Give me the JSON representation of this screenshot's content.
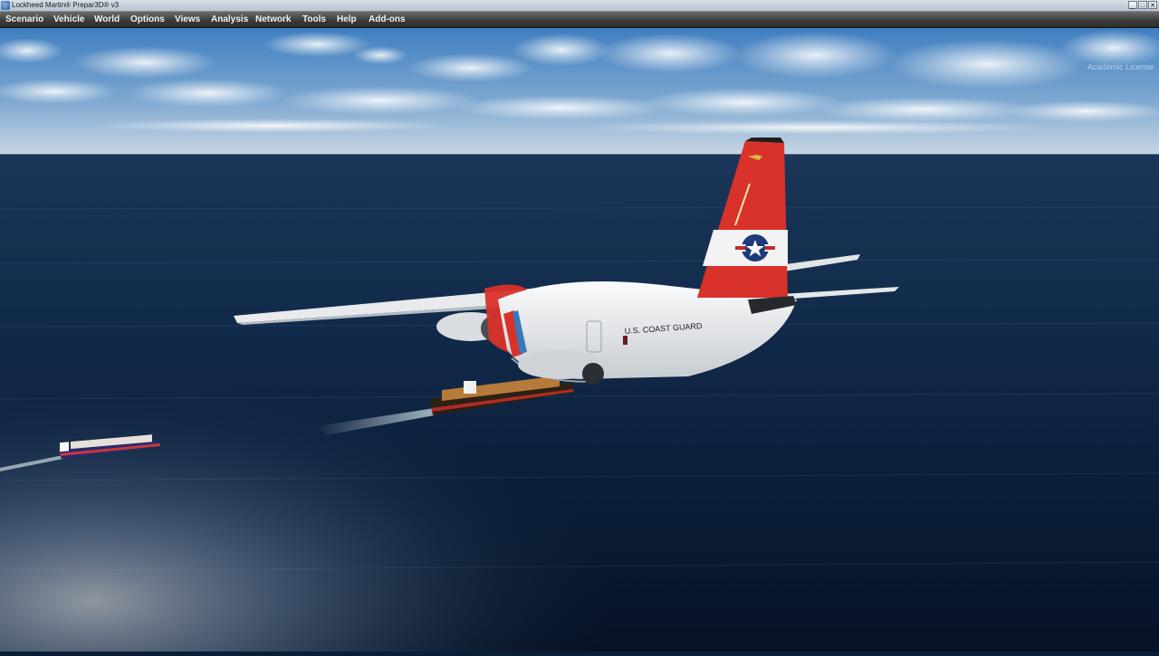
{
  "window": {
    "title": "Lockheed Martin® Prepar3D® v3",
    "controls": {
      "minimize": "_",
      "maximize": "□",
      "close": "✕"
    }
  },
  "menu": {
    "items": [
      "Scenario",
      "Vehicle",
      "World",
      "Options",
      "Views",
      "Analysis",
      "Network",
      "Tools",
      "Help",
      "Add-ons"
    ]
  },
  "overlay": {
    "watermark": "Academic License"
  },
  "scene": {
    "aircraft_livery_text": "U.S. COAST GUARD",
    "colors": {
      "sky_top": "#3f7fc0",
      "sky_horizon": "#c8d6e4",
      "ocean_far": "#1b3658",
      "ocean_near": "#071428",
      "livery_red": "#d8322a",
      "fuselage_white": "#eef0f2"
    }
  }
}
